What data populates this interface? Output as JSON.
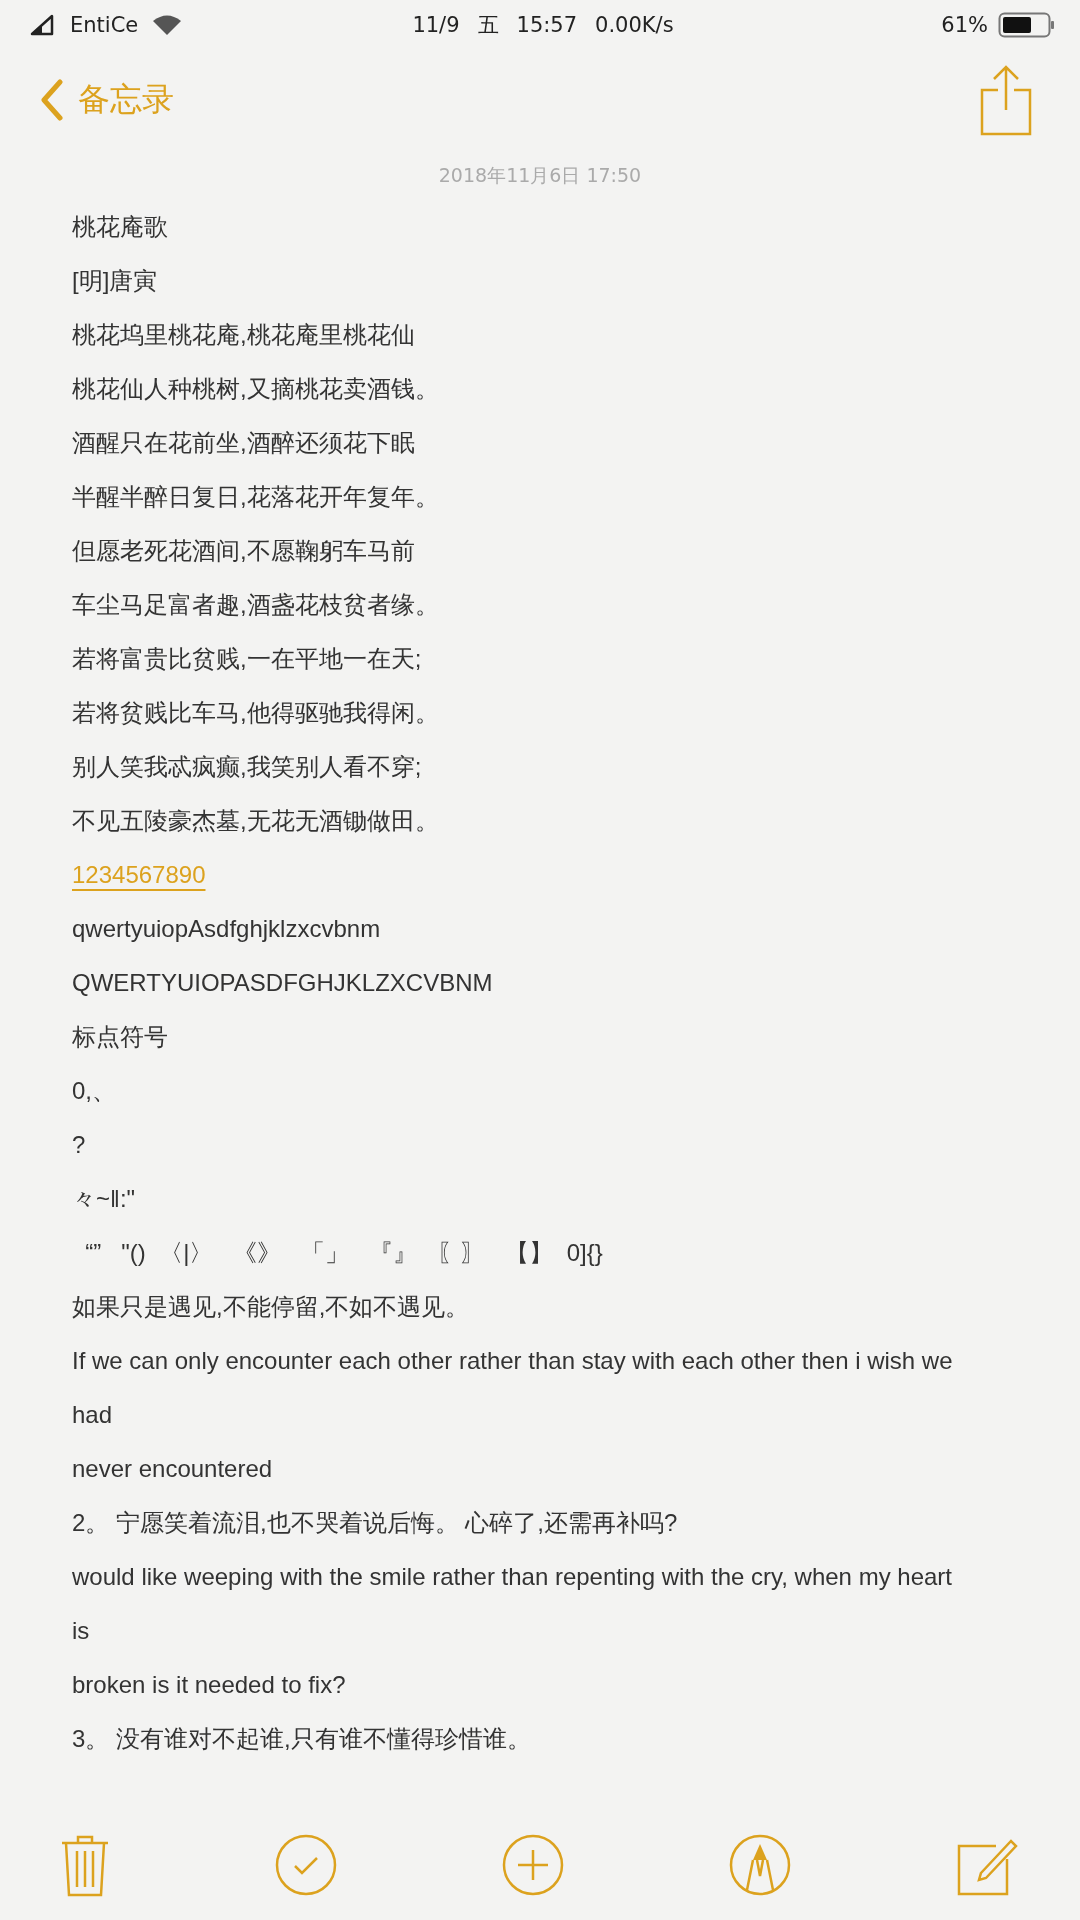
{
  "status_bar": {
    "carrier": "EntiCe",
    "date": "11/9",
    "weekday": "五",
    "time": "15:57",
    "speed": "0.00K/s",
    "battery": "61%"
  },
  "nav": {
    "back_label": "备忘录"
  },
  "note": {
    "timestamp": "2018年11月6日 17:50",
    "lines": [
      {
        "kind": "text",
        "text": "桃花庵歌"
      },
      {
        "kind": "text",
        "text": "[明]唐寅"
      },
      {
        "kind": "text",
        "text": "桃花坞里桃花庵,桃花庵里桃花仙"
      },
      {
        "kind": "text",
        "text": "桃花仙人种桃树,又摘桃花卖酒钱。"
      },
      {
        "kind": "text",
        "text": "酒醒只在花前坐,酒醉还须花下眠"
      },
      {
        "kind": "text",
        "text": "半醒半醉日复日,花落花开年复年。"
      },
      {
        "kind": "text",
        "text": "但愿老死花酒间,不愿鞠躬车马前"
      },
      {
        "kind": "text",
        "text": "车尘马足富者趣,酒盏花枝贫者缘。"
      },
      {
        "kind": "text",
        "text": "若将富贵比贫贱,一在平地一在天;"
      },
      {
        "kind": "text",
        "text": "若将贫贱比车马,他得驱驰我得闲。"
      },
      {
        "kind": "text",
        "text": "别人笑我忒疯癫,我笑别人看不穿;"
      },
      {
        "kind": "text",
        "text": "不见五陵豪杰墓,无花无酒锄做田。"
      },
      {
        "kind": "link",
        "text": "1234567890"
      },
      {
        "kind": "text",
        "text": "qwertyuiopAsdfghjklzxcvbnm"
      },
      {
        "kind": "text",
        "text": "QWERTYUIOPASDFGHJKLZXCVBNM"
      },
      {
        "kind": "text",
        "text": "标点符号"
      },
      {
        "kind": "text",
        "text": "0,、"
      },
      {
        "kind": "text",
        "text": "?"
      },
      {
        "kind": "text",
        "text": "々~‖:\""
      },
      {
        "kind": "text",
        "text": "  “”   \"()  〈|〉   《》   「」   『』   〖〗   【】  0]{}"
      },
      {
        "kind": "text",
        "text": "如果只是遇见,不能停留,不如不遇见。"
      },
      {
        "kind": "text",
        "text": "If we can only encounter each other rather than stay with each other then i wish we"
      },
      {
        "kind": "text",
        "text": "had"
      },
      {
        "kind": "text",
        "text": "never encountered"
      },
      {
        "kind": "text",
        "text": "2。 宁愿笑着流泪,也不哭着说后悔。 心碎了,还需再补吗?"
      },
      {
        "kind": "text",
        "text": "would like weeping with the smile rather than repenting with the cry, when my heart"
      },
      {
        "kind": "text",
        "text": "is"
      },
      {
        "kind": "text",
        "text": "broken is it needed to fix?"
      },
      {
        "kind": "text",
        "text": "3。 没有谁对不起谁,只有谁不懂得珍惜谁。"
      }
    ]
  }
}
